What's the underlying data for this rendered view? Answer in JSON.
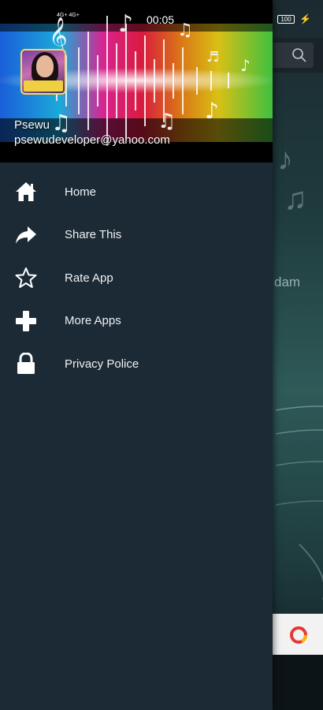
{
  "status_bar": {
    "signal_text": "4G+ 4G+",
    "time": "00:05",
    "battery": "100"
  },
  "drawer": {
    "user_name": "Psewu",
    "user_email": "psewudeveloper@yahoo.com",
    "items": [
      {
        "label": "Home",
        "icon": "home-icon"
      },
      {
        "label": "Share This",
        "icon": "share-icon"
      },
      {
        "label": "Rate App",
        "icon": "star-icon"
      },
      {
        "label": "More Apps",
        "icon": "plus-icon"
      },
      {
        "label": "Privacy Police",
        "icon": "lock-icon"
      }
    ]
  },
  "background": {
    "partial_text": "dam"
  },
  "colors": {
    "drawer_bg": "#1c2a35",
    "text": "#eef2f4"
  }
}
